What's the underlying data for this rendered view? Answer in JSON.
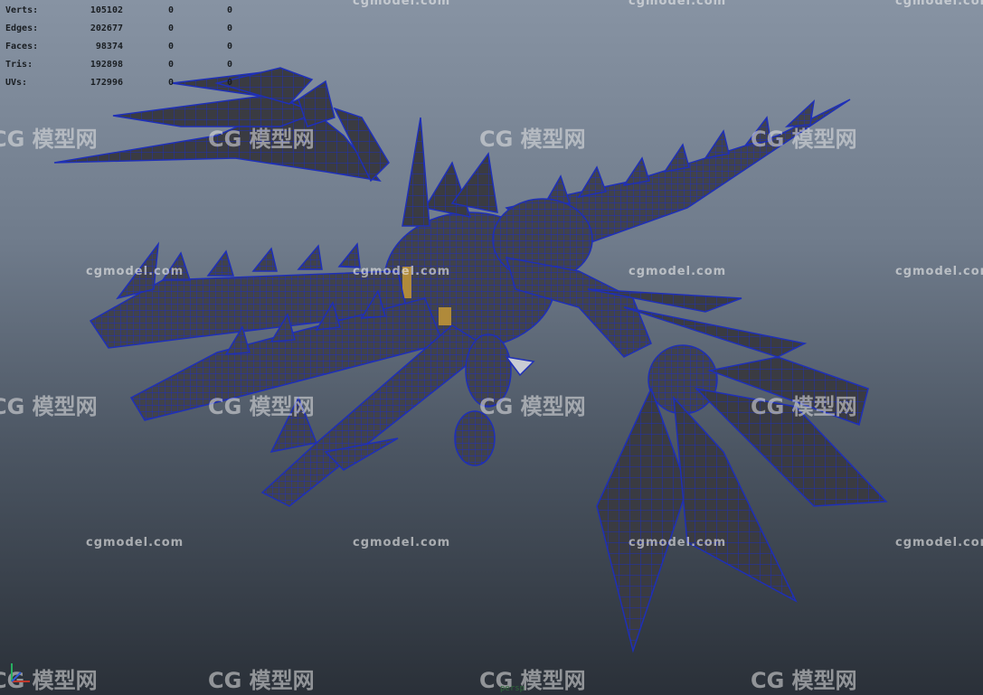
{
  "stats": {
    "rows": [
      {
        "label": "Verts:",
        "v1": "105102",
        "v2": "0",
        "v3": "0"
      },
      {
        "label": "Edges:",
        "v1": "202677",
        "v2": "0",
        "v3": "0"
      },
      {
        "label": "Faces:",
        "v1": "98374",
        "v2": "0",
        "v3": "0"
      },
      {
        "label": "Tris:",
        "v1": "192898",
        "v2": "0",
        "v3": "0"
      },
      {
        "label": "UVs:",
        "v1": "172996",
        "v2": "0",
        "v3": "0"
      }
    ]
  },
  "watermarks": {
    "url": "cgmodel.com",
    "logo": "模型网",
    "logo_prefix": "CG"
  },
  "viewport": {
    "camera_label": "persp"
  },
  "colors": {
    "wireframe": "#1e2fb8",
    "mesh_fill": "#3a3b40",
    "accent_gold": "#b08a3a"
  }
}
